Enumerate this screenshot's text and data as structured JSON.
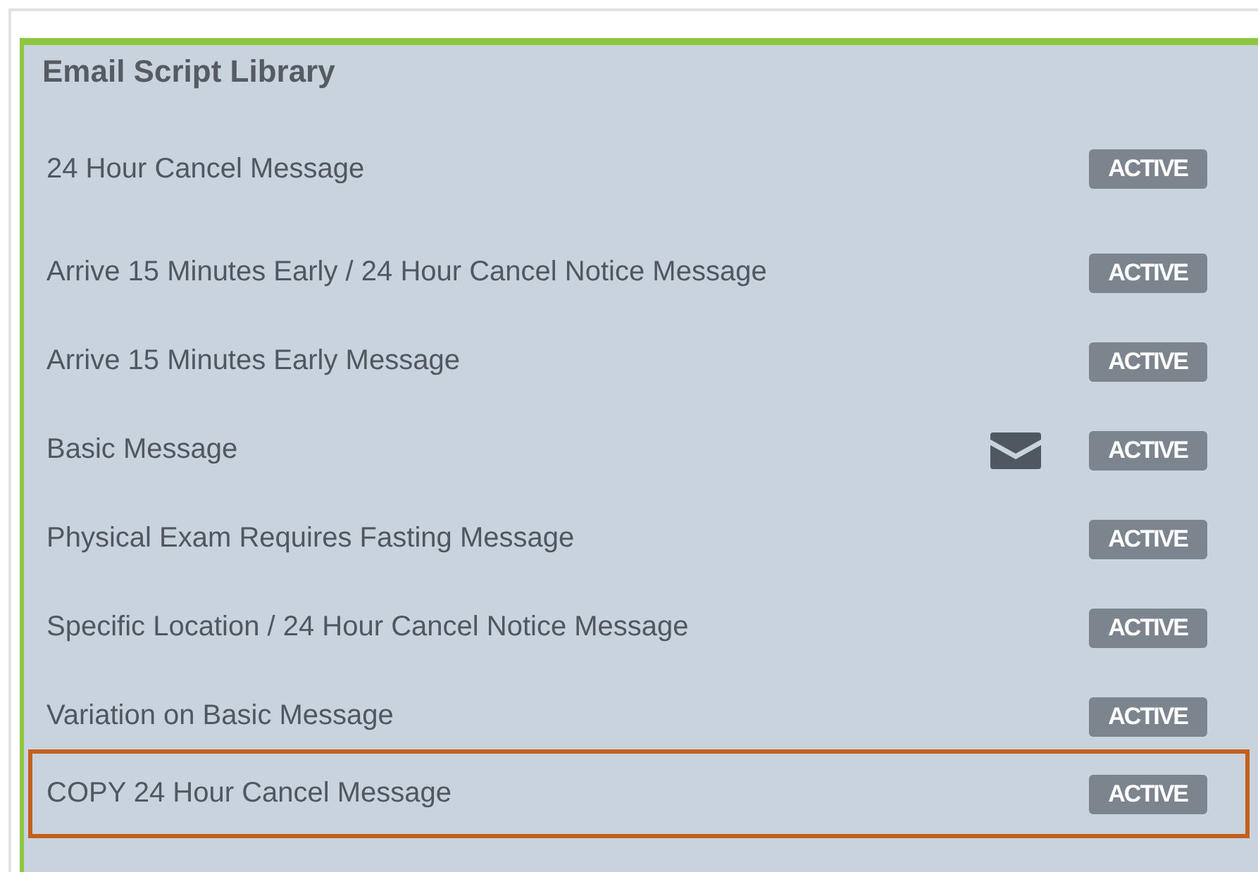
{
  "panel": {
    "title": "Email Script Library"
  },
  "scripts": [
    {
      "name": "24 Hour Cancel Message",
      "status": "ACTIVE",
      "has_email": false,
      "highlighted": false
    },
    {
      "name": "Arrive 15 Minutes Early / 24 Hour Cancel Notice Message",
      "status": "ACTIVE",
      "has_email": false,
      "highlighted": false
    },
    {
      "name": "Arrive 15 Minutes Early Message",
      "status": "ACTIVE",
      "has_email": false,
      "highlighted": false
    },
    {
      "name": "Basic Message",
      "status": "ACTIVE",
      "has_email": true,
      "highlighted": false
    },
    {
      "name": "Physical Exam Requires Fasting Message",
      "status": "ACTIVE",
      "has_email": false,
      "highlighted": false
    },
    {
      "name": "Specific Location / 24 Hour Cancel Notice Message",
      "status": "ACTIVE",
      "has_email": false,
      "highlighted": false
    },
    {
      "name": "Variation on Basic Message",
      "status": "ACTIVE",
      "has_email": false,
      "highlighted": false
    },
    {
      "name": "COPY 24 Hour Cancel Message",
      "status": "ACTIVE",
      "has_email": false,
      "highlighted": true
    }
  ]
}
